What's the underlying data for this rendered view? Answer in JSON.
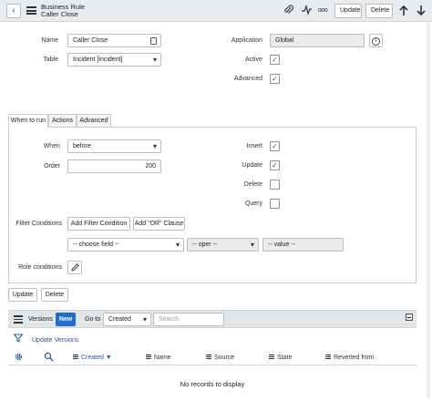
{
  "header": {
    "title": "Business Rule",
    "subtitle": "Caller Close",
    "update_label": "Update",
    "delete_label": "Delete",
    "more_label": "ooo"
  },
  "form": {
    "name_label": "Name",
    "name_value": "Caller Close",
    "table_label": "Table",
    "table_value": "Incident [incident]",
    "application_label": "Application",
    "application_value": "Global",
    "active_label": "Active",
    "active_checked": true,
    "advanced_label": "Advanced",
    "advanced_checked": true
  },
  "tabs": [
    {
      "label": "When to run",
      "active": true
    },
    {
      "label": "Actions",
      "active": false
    },
    {
      "label": "Advanced",
      "active": false
    }
  ],
  "when_to_run": {
    "when_label": "When",
    "when_value": "before",
    "order_label": "Order",
    "order_value": "200",
    "insert_label": "Insert",
    "update_label": "Update",
    "delete_label": "Delete",
    "query_label": "Query",
    "filter_label": "Filter Conditions",
    "add_filter_label": "Add Filter Condition",
    "add_or_label": "Add \"OR\" Clause",
    "choose_field": "-- choose field --",
    "oper": "-- oper --",
    "value": "-- value --",
    "role_label": "Role conditions"
  },
  "footer_buttons": {
    "update": "Update",
    "delete": "Delete"
  },
  "related_list": {
    "title": "Versions",
    "new_label": "New",
    "goto_label": "Go to",
    "goto_value": "Created",
    "search_placeholder": "Search",
    "update_versions_label": "Update Versions",
    "columns": [
      "Created",
      "Name",
      "Source",
      "State",
      "Reverted from"
    ],
    "sort_indicator": "▼",
    "empty_text": "No records to display"
  },
  "colors": {
    "accent": "#1f6fd1",
    "link": "#1f5b9c",
    "header_bg": "#e9ecef"
  },
  "icons": [
    "back-icon",
    "menu-icon",
    "attachment-icon",
    "activity-icon",
    "more-icon",
    "arrow-up-icon",
    "arrow-down-icon",
    "lookup-icon",
    "info-icon",
    "pencil-icon",
    "filter-icon",
    "gear-icon",
    "search-icon",
    "collapse-icon"
  ]
}
